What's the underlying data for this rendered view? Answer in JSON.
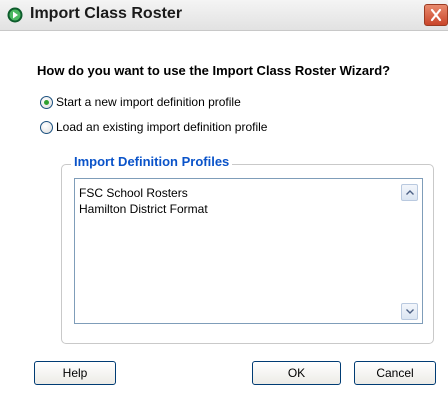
{
  "window": {
    "title": "Import Class Roster"
  },
  "question": "How do you want to use the Import Class Roster Wizard?",
  "options": [
    {
      "label": "Start a new import definition profile",
      "checked": true
    },
    {
      "label": "Load an existing import definition profile",
      "checked": false
    }
  ],
  "profiles": {
    "title": "Import Definition Profiles",
    "items": [
      "FSC School Rosters",
      "Hamilton District Format"
    ]
  },
  "buttons": {
    "help": "Help",
    "ok": "OK",
    "cancel": "Cancel"
  },
  "colors": {
    "accent_blue": "#0a53c9",
    "radio_dot": "#2fa02f",
    "close_red": "#c9452a"
  }
}
